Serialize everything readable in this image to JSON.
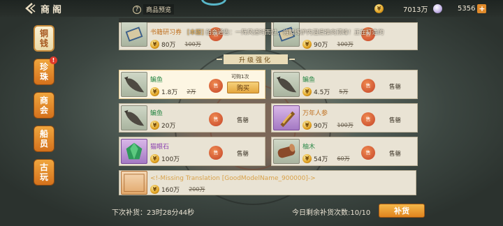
{
  "header": {
    "title": "商阁",
    "preview_label": "商品预览",
    "preview_icon": "?",
    "gold_amount": "7013万",
    "pearl_amount": "5356",
    "plus_label": "+"
  },
  "tabs": [
    {
      "label": "铜钱",
      "active": true,
      "badge": ""
    },
    {
      "label": "珍珠",
      "active": false,
      "badge": "!"
    },
    {
      "label": "商会",
      "active": false,
      "badge": ""
    },
    {
      "label": "船员",
      "active": false,
      "badge": ""
    },
    {
      "label": "古玩",
      "active": false,
      "badge": ""
    }
  ],
  "notice": {
    "tag": "[本服]",
    "text": "舶会通告：一阵风适时而过，将精炼炉内温度推向顶峰！正在打造的"
  },
  "section_title": "升级强化",
  "top_cards": [
    {
      "name": "书籍研习券",
      "price": "80万",
      "old_price": "100万"
    },
    {
      "name": "",
      "price": "90万",
      "old_price": "100万"
    }
  ],
  "cards": [
    {
      "name": "鳊鱼",
      "price": "1.8万",
      "old_price": "2万",
      "status": "",
      "buy": "购买",
      "buy_count": "可购1次",
      "rarity": "green",
      "selected": true
    },
    {
      "name": "鳊鱼",
      "price": "4.5万",
      "old_price": "5万",
      "status": "售罄",
      "rarity": "green"
    },
    {
      "name": "鳊鱼",
      "price": "20万",
      "old_price": "",
      "status": "售罄",
      "rarity": "green"
    },
    {
      "name": "万年人参",
      "price": "90万",
      "old_price": "100万",
      "status": "售罄",
      "rarity": "purple"
    },
    {
      "name": "猫眼石",
      "price": "100万",
      "old_price": "",
      "status": "售罄",
      "rarity": "purple"
    },
    {
      "name": "柚木",
      "price": "54万",
      "old_price": "60万",
      "status": "售罄",
      "rarity": "green"
    }
  ],
  "wide_card": {
    "name": "<!-Missing Translation [GoodModelName_900000]->",
    "price": "160万",
    "old_price": "200万",
    "rarity": "orange"
  },
  "coin_glyph": "¥",
  "sold_glyph": "售",
  "footer": {
    "next_restock_label": "下次补货：",
    "next_restock_time": "23时28分44秒",
    "remaining_label": "今日剩余补货次数:",
    "remaining_count": "10/10",
    "restock_button": "补货"
  }
}
